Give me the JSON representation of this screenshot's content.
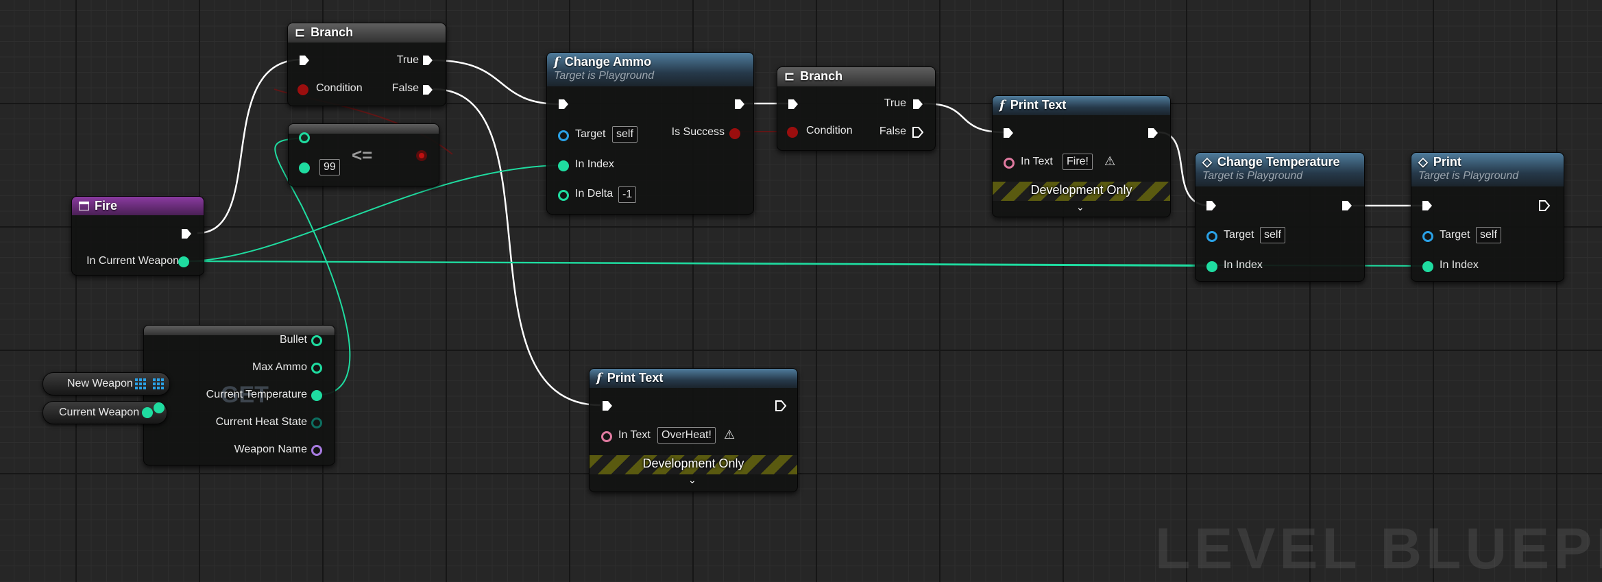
{
  "graph": {
    "watermark": "LEVEL BLUEPRINT"
  },
  "nodes": {
    "fire_event": {
      "title": "Fire",
      "pin_in_current_weapon": "In Current Weapon"
    },
    "branch1": {
      "title": "Branch",
      "pin_condition": "Condition",
      "pin_true": "True",
      "pin_false": "False"
    },
    "compare": {
      "operator": "<=",
      "b_value": "99"
    },
    "change_ammo": {
      "title": "Change Ammo",
      "subtitle": "Target is Playground",
      "pin_target": "Target",
      "target_value": "self",
      "pin_is_success": "Is Success",
      "pin_in_index": "In Index",
      "pin_in_delta": "In Delta",
      "delta_value": "-1"
    },
    "branch2": {
      "title": "Branch",
      "pin_condition": "Condition",
      "pin_true": "True",
      "pin_false": "False"
    },
    "print_fire": {
      "title": "Print Text",
      "pin_in_text": "In Text",
      "text_value": "Fire!",
      "dev_label": "Development Only"
    },
    "change_temp": {
      "title": "Change Temperature",
      "subtitle": "Target is Playground",
      "pin_target": "Target",
      "target_value": "self",
      "pin_in_index": "In Index"
    },
    "print_node": {
      "title": "Print",
      "subtitle": "Target is Playground",
      "pin_target": "Target",
      "target_value": "self",
      "pin_in_index": "In Index"
    },
    "break_struct": {
      "bg_label": "GET",
      "fields": [
        "Bullet",
        "Max Ammo",
        "Current Temperature",
        "Current Heat State",
        "Weapon Name"
      ]
    },
    "var_new_weapon": {
      "label": "New Weapon"
    },
    "var_current_weapon": {
      "label": "Current Weapon"
    },
    "print_overheat": {
      "title": "Print Text",
      "pin_in_text": "In Text",
      "text_value": "OverHeat!",
      "dev_label": "Development Only"
    }
  },
  "colors": {
    "exec_wire": "#ffffff",
    "int_pin": "#1fdca0",
    "object_pin": "#2aa1e6",
    "bool_pin": "#9b0e0e",
    "text_pin": "#e07aa0",
    "name_pin": "#a77be0",
    "function_header": "#3f6684",
    "event_header": "#7a2f8f"
  }
}
